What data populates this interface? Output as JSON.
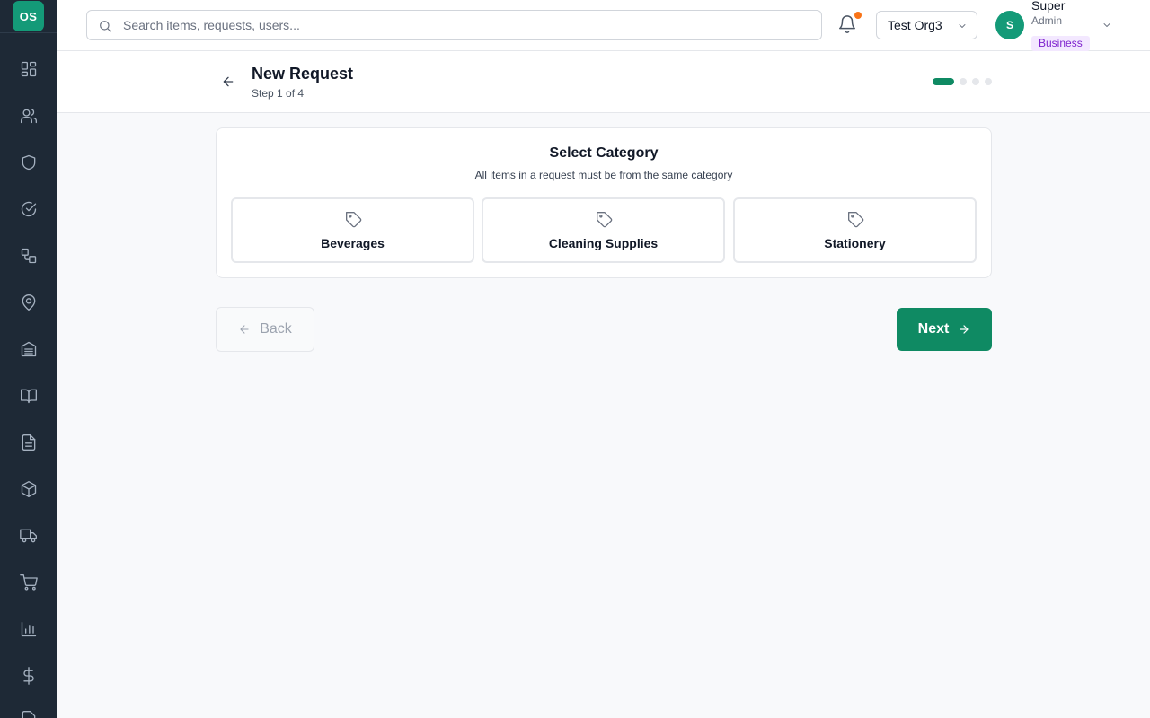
{
  "app": {
    "logo_text": "OS",
    "accent_color": "#0f8a63"
  },
  "sidebar": {
    "items": [
      {
        "icon": "dashboard-icon"
      },
      {
        "icon": "users-icon"
      },
      {
        "icon": "shield-icon"
      },
      {
        "icon": "check-circle-icon"
      },
      {
        "icon": "workflow-icon"
      },
      {
        "icon": "map-pin-icon"
      },
      {
        "icon": "warehouse-icon"
      },
      {
        "icon": "book-icon"
      },
      {
        "icon": "document-icon"
      },
      {
        "icon": "package-icon"
      },
      {
        "icon": "truck-icon"
      },
      {
        "icon": "cart-icon"
      },
      {
        "icon": "bar-chart-icon"
      },
      {
        "icon": "dollar-icon"
      },
      {
        "icon": "file-icon"
      }
    ]
  },
  "header": {
    "search_placeholder": "Search items, requests, users...",
    "org_name": "Test Org3",
    "user_initial": "S",
    "user_name": "Super",
    "user_role": "Admin",
    "plan_badge": "Business"
  },
  "page": {
    "title": "New Request",
    "step_text": "Step 1 of 4",
    "step_current": 1,
    "step_total": 4
  },
  "category_card": {
    "title": "Select Category",
    "subtitle": "All items in a request must be from the same category",
    "categories": [
      "Beverages",
      "Cleaning Supplies",
      "Stationery"
    ]
  },
  "actions": {
    "back_label": "Back",
    "next_label": "Next"
  }
}
